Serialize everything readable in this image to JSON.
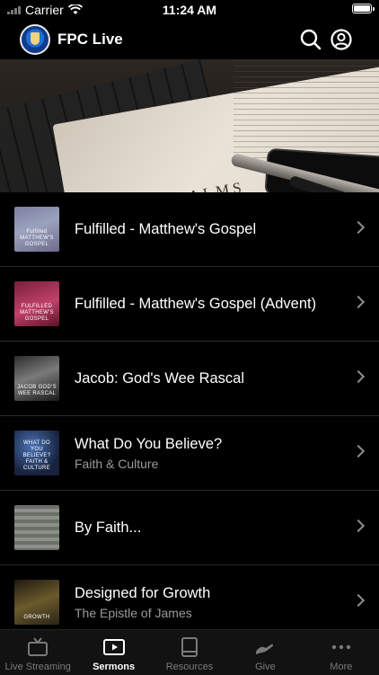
{
  "status_bar": {
    "carrier": "Carrier",
    "time": "11:24 AM"
  },
  "header": {
    "title": "FPC Live",
    "icons": [
      "fpc-logo-icon",
      "search-icon",
      "account-icon"
    ]
  },
  "hero": {
    "image_text": "PSALMS"
  },
  "sermons": [
    {
      "title": "Fulfilled - Matthew's Gospel",
      "subtitle": "",
      "thumb_text": "Fulfilled MATTHEW'S GOSPEL"
    },
    {
      "title": "Fulfilled - Matthew's Gospel (Advent)",
      "subtitle": "",
      "thumb_text": "FULFILLED MATTHEW'S GOSPEL"
    },
    {
      "title": "Jacob: God's Wee Rascal",
      "subtitle": "",
      "thumb_text": "JACOB GOD'S WEE RASCAL"
    },
    {
      "title": "What Do You Believe?",
      "subtitle": "Faith & Culture",
      "thumb_text": "WHAT DO YOU BELIEVE? FAITH & CULTURE"
    },
    {
      "title": "By Faith...",
      "subtitle": "",
      "thumb_text": ""
    },
    {
      "title": "Designed for Growth",
      "subtitle": "The Epistle of James",
      "thumb_text": "GROWTH"
    }
  ],
  "tabs": [
    {
      "label": "Live Streaming",
      "icon": "tv-icon"
    },
    {
      "label": "Sermons",
      "icon": "play-icon",
      "active": true
    },
    {
      "label": "Resources",
      "icon": "book-icon"
    },
    {
      "label": "Give",
      "icon": "give-hand-icon"
    },
    {
      "label": "More",
      "icon": "more-icon"
    }
  ],
  "colors": {
    "background": "#000000",
    "tab_bar": "#121212",
    "active_tab": "#ffffff",
    "inactive_tab": "#7a7a7a",
    "subtitle": "#9a9a9a"
  }
}
